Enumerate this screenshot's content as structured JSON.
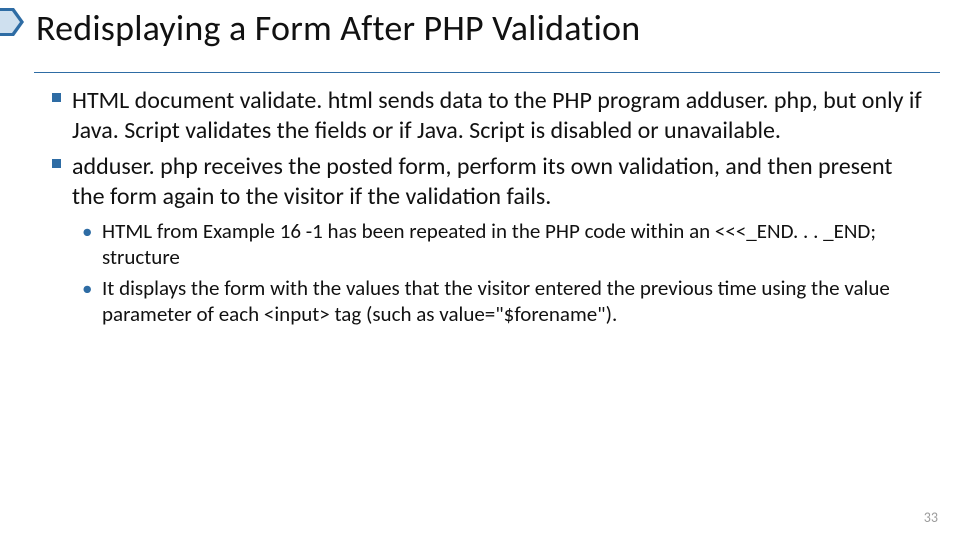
{
  "title": "Redisplaying a Form After PHP Validation",
  "bullets": [
    {
      "level": 1,
      "text": "HTML document validate. html sends data to the PHP program adduser. php, but only if Java. Script validates the fields or if Java. Script is disabled or unavailable."
    },
    {
      "level": 1,
      "text": "adduser. php receives the posted form, perform its own validation, and then present the form again to the visitor if the validation fails."
    },
    {
      "level": 2,
      "text": "HTML from Example 16 -1 has been repeated in the PHP code within an <<<_END. . . _END; structure"
    },
    {
      "level": 2,
      "text": "It displays the form with the values that the visitor entered the previous time using the value parameter of each <input> tag (such as value=\"$forename\")."
    }
  ],
  "page_number": "33",
  "colors": {
    "accent": "#2e6ca4"
  }
}
